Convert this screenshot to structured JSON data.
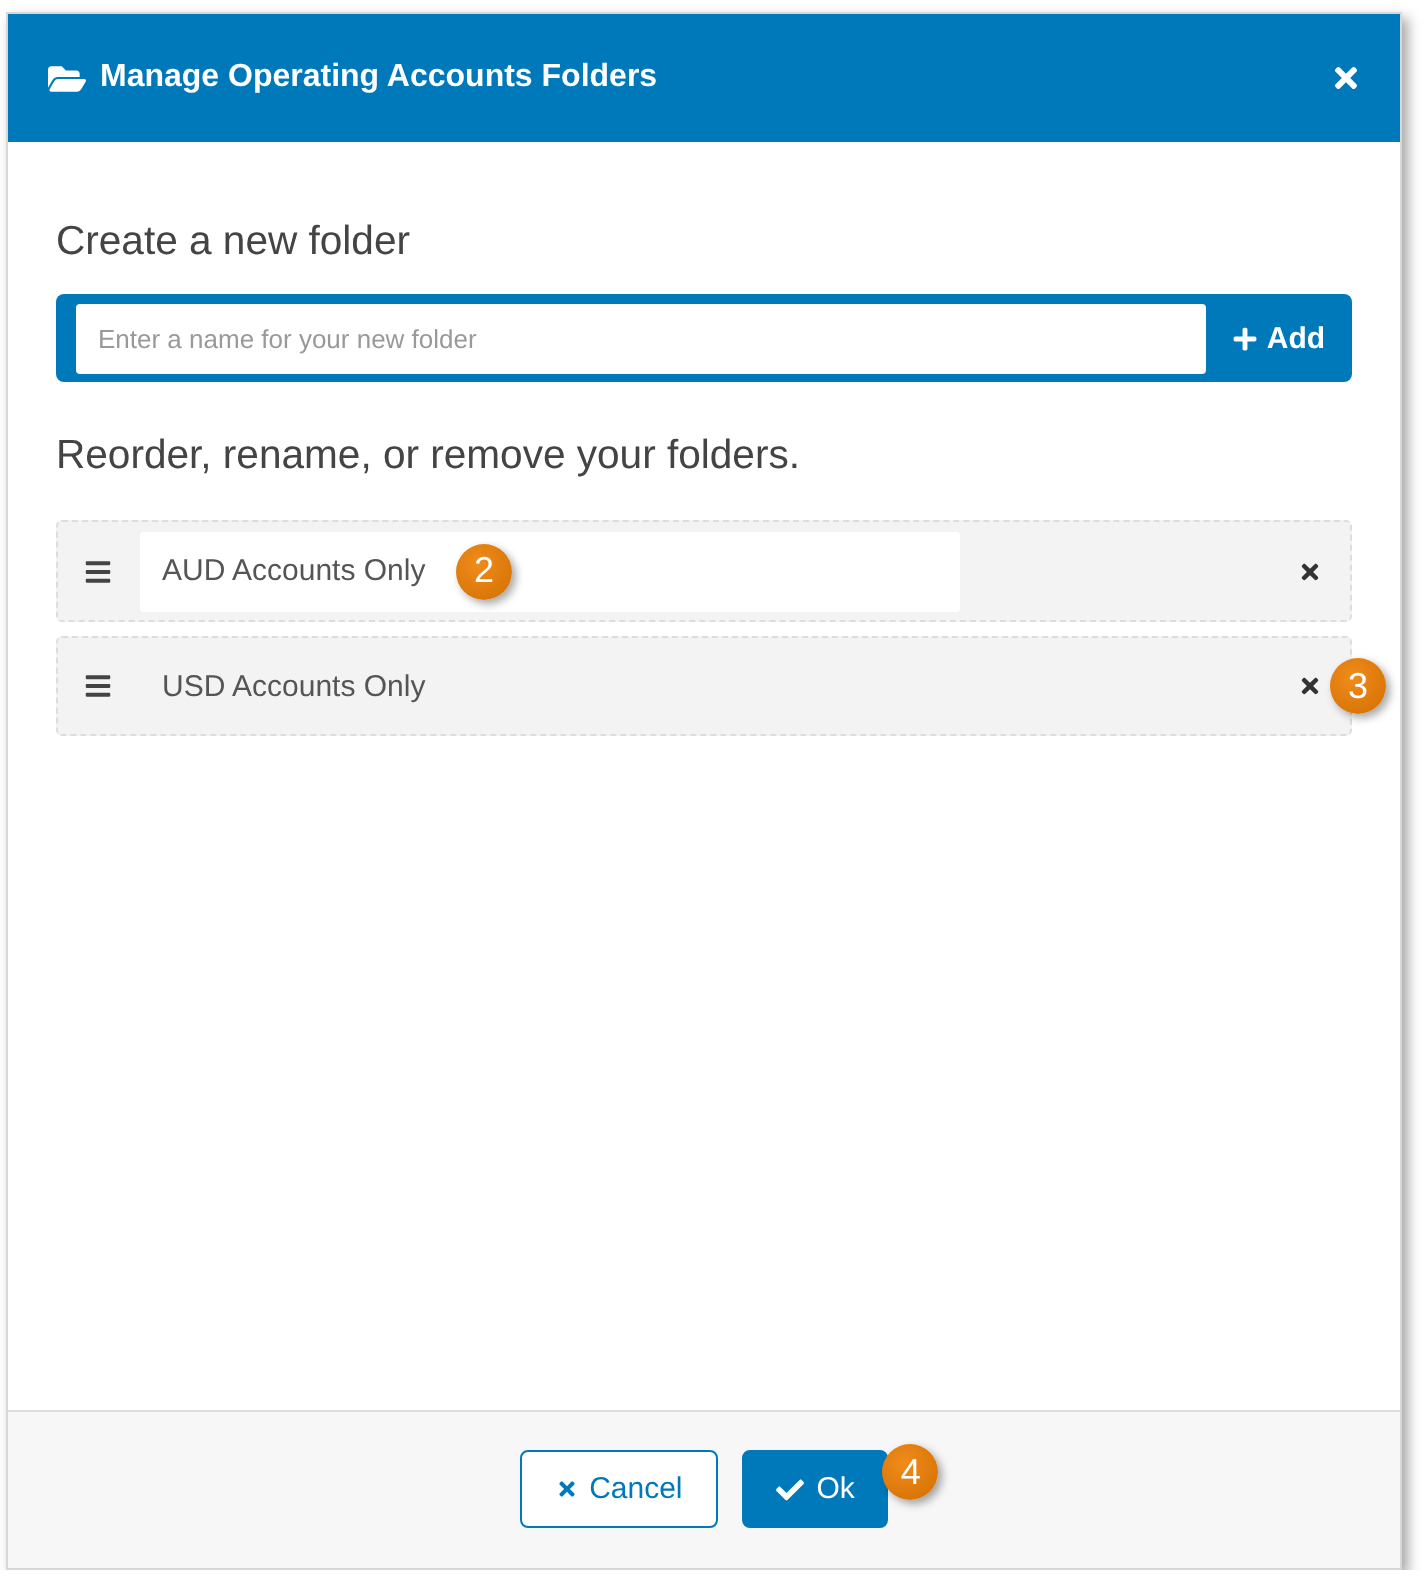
{
  "dialog": {
    "title": "Manage Operating Accounts Folders"
  },
  "create_section": {
    "heading": "Create a new folder",
    "input": {
      "placeholder": "Enter a name for your new folder"
    },
    "add_button": "Add"
  },
  "folders_section": {
    "heading": "Reorder, rename, or remove your folders.",
    "folders": [
      {
        "name": "AUD Accounts Only",
        "editing": true,
        "name_callout": "2"
      },
      {
        "name": "USD Accounts Only",
        "editing": false,
        "remove_callout": "3"
      }
    ]
  },
  "footer": {
    "buttons": [
      {
        "kind": "secondary",
        "label": "Cancel"
      },
      {
        "kind": "primary",
        "label": "Ok",
        "callout": "4"
      }
    ]
  }
}
